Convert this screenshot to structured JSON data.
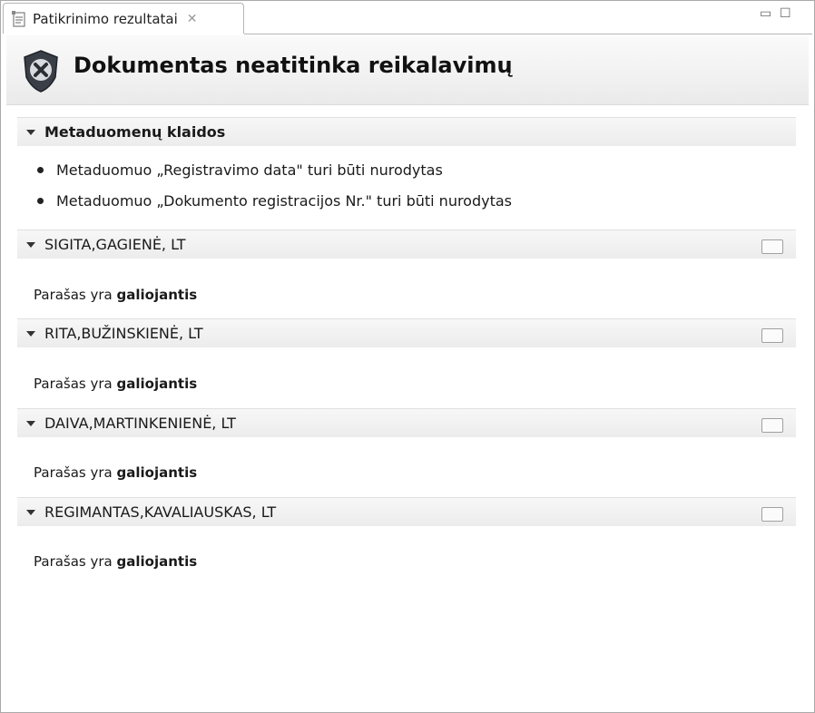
{
  "tab": {
    "label": "Patikrinimo rezultatai"
  },
  "header": {
    "title": "Dokumentas neatitinka reikalavimų"
  },
  "metadata_section": {
    "title": "Metaduomenų klaidos",
    "errors": [
      "Metaduomuo „Registravimo data\" turi būti nurodytas",
      "Metaduomuo „Dokumento registracijos Nr.\" turi būti nurodytas"
    ]
  },
  "signatures": [
    {
      "name": "SIGITA,GAGIENĖ, LT",
      "status_prefix": "Parašas yra ",
      "status_value": "galiojantis"
    },
    {
      "name": "RITA,BUŽINSKIENĖ, LT",
      "status_prefix": "Parašas yra ",
      "status_value": "galiojantis"
    },
    {
      "name": "DAIVA,MARTINKENIENĖ, LT",
      "status_prefix": "Parašas yra ",
      "status_value": "galiojantis"
    },
    {
      "name": "REGIMANTAS,KAVALIAUSKAS, LT",
      "status_prefix": "Parašas yra ",
      "status_value": "galiojantis"
    }
  ],
  "colors": {
    "error_icon": "#3a3f47",
    "section_bg": "#ececec"
  }
}
